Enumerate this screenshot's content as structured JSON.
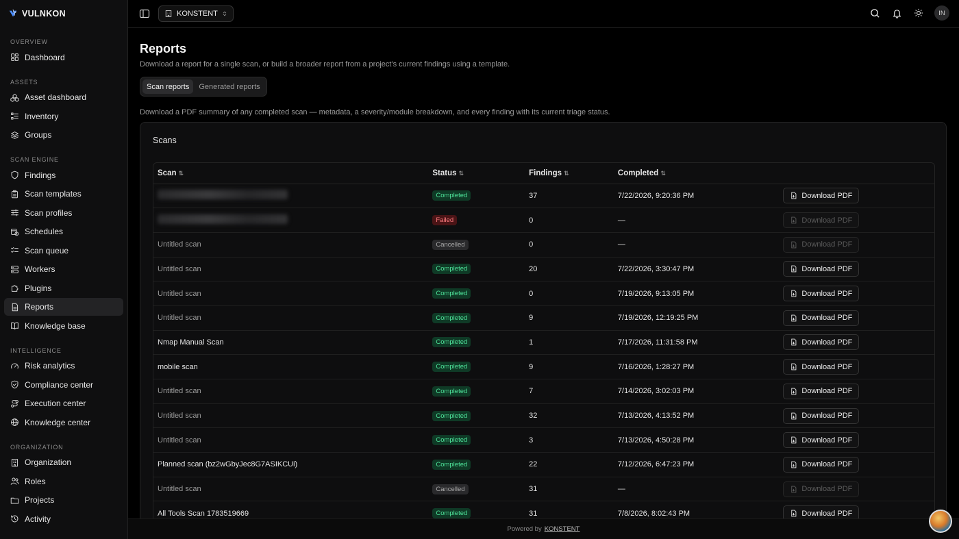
{
  "brand": {
    "name": "VULNKON"
  },
  "sidebar": {
    "sections": [
      {
        "heading": "OVERVIEW",
        "items": [
          {
            "label": "Dashboard",
            "icon": "dashboard-icon"
          }
        ]
      },
      {
        "heading": "ASSETS",
        "items": [
          {
            "label": "Asset dashboard",
            "icon": "boxes-icon"
          },
          {
            "label": "Inventory",
            "icon": "list-icon"
          },
          {
            "label": "Groups",
            "icon": "layers-icon"
          }
        ]
      },
      {
        "heading": "SCAN ENGINE",
        "items": [
          {
            "label": "Findings",
            "icon": "shield-icon"
          },
          {
            "label": "Scan templates",
            "icon": "clipboard-icon"
          },
          {
            "label": "Scan profiles",
            "icon": "sliders-icon"
          },
          {
            "label": "Schedules",
            "icon": "calendar-clock-icon"
          },
          {
            "label": "Scan queue",
            "icon": "list-checks-icon"
          },
          {
            "label": "Workers",
            "icon": "server-icon"
          },
          {
            "label": "Plugins",
            "icon": "puzzle-icon"
          },
          {
            "label": "Reports",
            "icon": "file-text-icon",
            "active": true
          },
          {
            "label": "Knowledge base",
            "icon": "book-icon"
          }
        ]
      },
      {
        "heading": "INTELLIGENCE",
        "items": [
          {
            "label": "Risk analytics",
            "icon": "gauge-icon"
          },
          {
            "label": "Compliance center",
            "icon": "shield-check-icon"
          },
          {
            "label": "Execution center",
            "icon": "route-icon"
          },
          {
            "label": "Knowledge center",
            "icon": "globe-icon"
          }
        ]
      },
      {
        "heading": "ORGANIZATION",
        "items": [
          {
            "label": "Organization",
            "icon": "building-icon"
          },
          {
            "label": "Roles",
            "icon": "users-icon"
          },
          {
            "label": "Projects",
            "icon": "folder-icon"
          },
          {
            "label": "Activity",
            "icon": "history-icon"
          }
        ]
      }
    ]
  },
  "topbar": {
    "org_name": "KONSTENT",
    "avatar_initials": "IN"
  },
  "page": {
    "title": "Reports",
    "subtitle": "Download a report for a single scan, or build a broader report from a project's current findings using a template.",
    "tabs": [
      "Scan reports",
      "Generated reports"
    ],
    "description": "Download a PDF summary of any completed scan — metadata, a severity/module breakdown, and every finding with its current triage status."
  },
  "scans_card": {
    "title": "Scans",
    "columns": {
      "scan": "Scan",
      "status": "Status",
      "findings": "Findings",
      "completed": "Completed"
    },
    "download_label": "Download PDF",
    "rows": [
      {
        "scan": "",
        "redacted": true,
        "status": "Completed",
        "findings": "37",
        "completed": "7/22/2026, 9:20:36 PM",
        "enabled": true
      },
      {
        "scan": "",
        "redacted": true,
        "status": "Failed",
        "findings": "0",
        "completed": "—",
        "enabled": false
      },
      {
        "scan": "Untitled scan",
        "muted": true,
        "status": "Cancelled",
        "findings": "0",
        "completed": "—",
        "enabled": false
      },
      {
        "scan": "Untitled scan",
        "muted": true,
        "status": "Completed",
        "findings": "20",
        "completed": "7/22/2026, 3:30:47 PM",
        "enabled": true
      },
      {
        "scan": "Untitled scan",
        "muted": true,
        "status": "Completed",
        "findings": "0",
        "completed": "7/19/2026, 9:13:05 PM",
        "enabled": true
      },
      {
        "scan": "Untitled scan",
        "muted": true,
        "status": "Completed",
        "findings": "9",
        "completed": "7/19/2026, 12:19:25 PM",
        "enabled": true
      },
      {
        "scan": "Nmap Manual Scan",
        "status": "Completed",
        "findings": "1",
        "completed": "7/17/2026, 11:31:58 PM",
        "enabled": true
      },
      {
        "scan": "mobile scan",
        "status": "Completed",
        "findings": "9",
        "completed": "7/16/2026, 1:28:27 PM",
        "enabled": true
      },
      {
        "scan": "Untitled scan",
        "muted": true,
        "status": "Completed",
        "findings": "7",
        "completed": "7/14/2026, 3:02:03 PM",
        "enabled": true
      },
      {
        "scan": "Untitled scan",
        "muted": true,
        "status": "Completed",
        "findings": "32",
        "completed": "7/13/2026, 4:13:52 PM",
        "enabled": true
      },
      {
        "scan": "Untitled scan",
        "muted": true,
        "status": "Completed",
        "findings": "3",
        "completed": "7/13/2026, 4:50:28 PM",
        "enabled": true
      },
      {
        "scan": "Planned scan (bz2wGbyJec8G7ASIKCUi)",
        "status": "Completed",
        "findings": "22",
        "completed": "7/12/2026, 6:47:23 PM",
        "enabled": true
      },
      {
        "scan": "Untitled scan",
        "muted": true,
        "status": "Cancelled",
        "findings": "31",
        "completed": "—",
        "enabled": false
      },
      {
        "scan": "All Tools Scan 1783519669",
        "status": "Completed",
        "findings": "31",
        "completed": "7/8/2026, 8:02:43 PM",
        "enabled": true
      }
    ]
  },
  "footer": {
    "prefix": "Powered by",
    "link": "KONSTENT"
  },
  "colors": {
    "accent_blue": "#3b82f6",
    "completed": "#4ee39a",
    "failed": "#ff7d80"
  }
}
